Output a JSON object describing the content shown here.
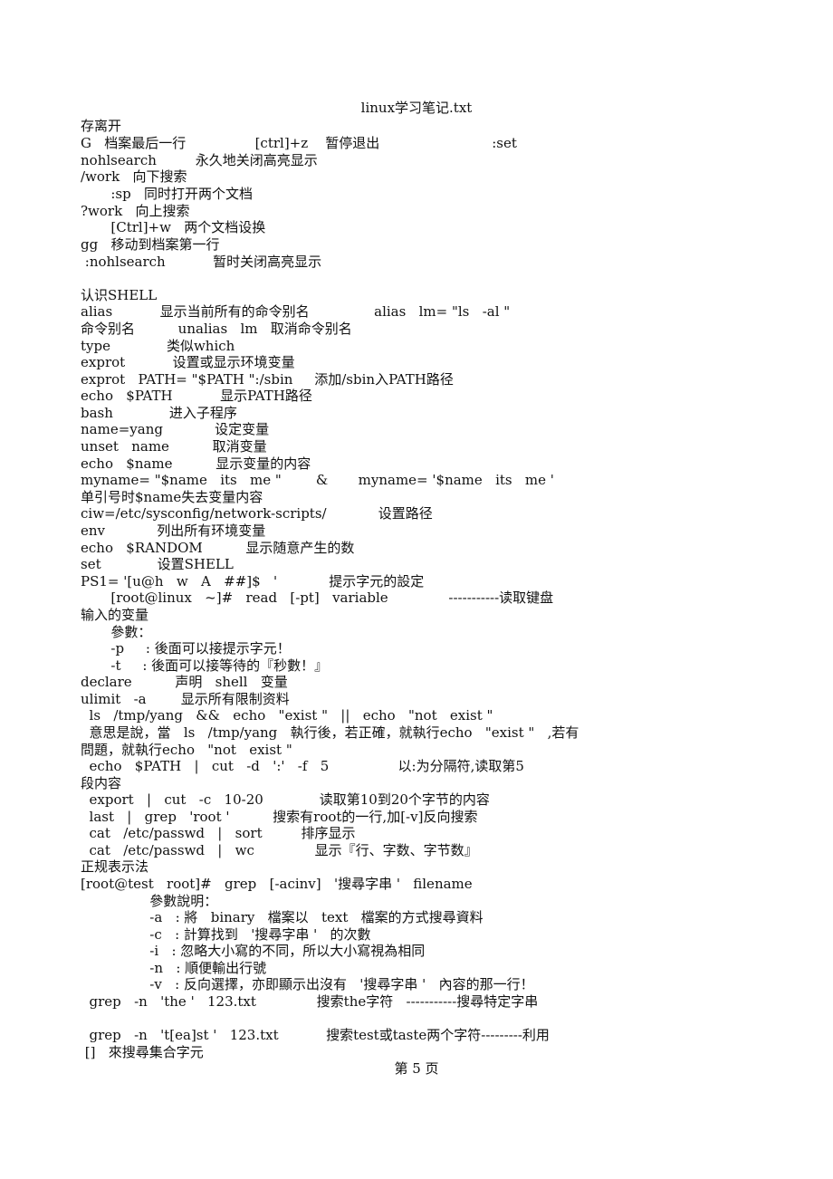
{
  "document": {
    "title": "linux学习笔记.txt",
    "footer": "第 5 页",
    "lines": [
      "存离开",
      "G   档案最后一行                [ctrl]+z    暂停退出                          :set",
      "nohlsearch         永久地关闭高亮显示",
      "/work   向下搜索",
      "       :sp   同时打开两个文档",
      "?work   向上搜索",
      "       [Ctrl]+w   两个文档设换",
      "gg   移动到档案第一行",
      " :nohlsearch           暂时关闭高亮显示",
      "",
      "认识SHELL",
      "alias           显示当前所有的命令别名               alias   lm= \"ls   -al \"",
      "命令别名          unalias   lm   取消命令别名",
      "type             类似which",
      "exprot           设置或显示环境变量",
      "exprot   PATH= \"$PATH \":/sbin     添加/sbin入PATH路径",
      "echo   $PATH           显示PATH路径",
      "bash             进入子程序",
      "name=yang            设定变量",
      "unset   name          取消变量",
      "echo   $name          显示变量的内容",
      "myname= \"$name   its   me \"        &       myname= '$name   its   me '",
      "单引号时$name失去变量内容",
      "ciw=/etc/sysconfig/network-scripts/            设置路径",
      "env            列出所有环境变量",
      "echo   $RANDOM          显示随意产生的数",
      "set             设置SHELL",
      "PS1= '[u@h   w   A   ##]$   '            提示字元的設定",
      "       [root@linux   ~]#   read   [-pt]   variable              -----------读取键盘",
      "输入的变量",
      "       參數：",
      "       -p     : 後面可以接提示字元！",
      "       -t     : 後面可以接等待的『秒數！』",
      "declare          声明   shell   变量",
      "ulimit   -a        显示所有限制资料",
      "  ls   /tmp/yang   &&   echo   \"exist \"   ||   echo   \"not   exist \"",
      "  意思是說，當   ls   /tmp/yang   執行後，若正確，就執行echo   \"exist \"   ,若有",
      "問題，就執行echo   \"not   exist \"",
      "  echo   $PATH   |   cut   -d   ':'   -f   5                以:为分隔符,读取第5",
      "段内容",
      "  export   |   cut   -c   10-20             读取第10到20个字节的内容",
      "  last   |   grep   'root '          搜索有root的一行,加[-v]反向搜索",
      "  cat   /etc/passwd   |   sort         排序显示",
      "  cat   /etc/passwd   |   wc              显示『行、字数、字节数』",
      "正规表示法",
      "[root@test   root]#   grep   [-acinv]   '搜尋字串 '   filename",
      "                參數說明：",
      "                -a   : 將   binary   檔案以   text   檔案的方式搜尋資料",
      "                -c   : 計算找到   '搜尋字串 '   的次數",
      "                -i   : 忽略大小寫的不同，所以大小寫視為相同",
      "                -n   : 順便輸出行號",
      "                -v   : 反向選擇，亦即顯示出沒有   '搜尋字串 '   內容的那一行！",
      "  grep   -n   'the '   123.txt              搜索the字符   -----------搜尋特定字串",
      "",
      "  grep   -n   't[ea]st '   123.txt           搜索test或taste两个字符---------利用",
      " []   來搜尋集合字元"
    ]
  }
}
